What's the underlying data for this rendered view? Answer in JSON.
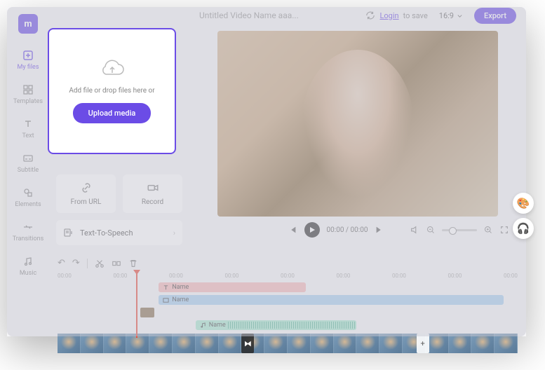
{
  "logo": "m",
  "rail": [
    {
      "label": "My files",
      "active": true
    },
    {
      "label": "Templates"
    },
    {
      "label": "Text"
    },
    {
      "label": "Subtitle"
    },
    {
      "label": "Elements"
    },
    {
      "label": "Transitions"
    },
    {
      "label": "Music"
    }
  ],
  "title": "Untitled Video Name aaa...",
  "login": {
    "link": "Login",
    "suffix": "to save"
  },
  "ratio": "16:9",
  "export": "Export",
  "sources": {
    "url": "From URL",
    "record": "Record",
    "tts": "Text-To-Speech"
  },
  "popup": {
    "text": "Add file or drop files here or",
    "button": "Upload media"
  },
  "playback": {
    "time": "00:00 / 00:00"
  },
  "ruler": [
    "00:00",
    "00:00",
    "00:00",
    "00:00",
    "00:00",
    "00:00",
    "00:00",
    "00:00",
    "00:00"
  ],
  "clips": {
    "text": "Name",
    "video": "Name",
    "audio": "Name"
  }
}
